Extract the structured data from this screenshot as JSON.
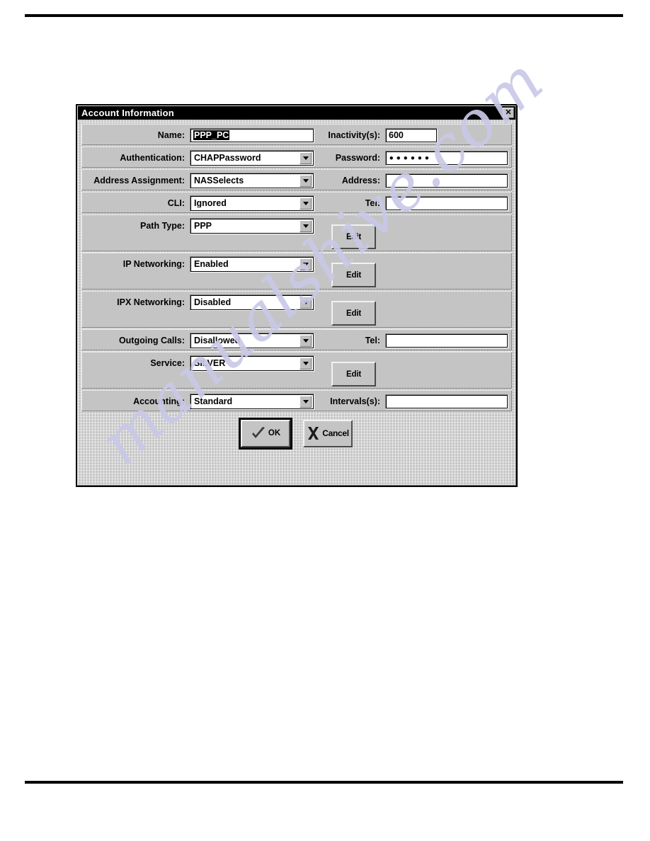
{
  "page": {
    "rule_top": "horizontal-rule",
    "rule_bottom": "horizontal-rule",
    "watermark": "manualshive.com"
  },
  "dialog": {
    "title": "Account Information",
    "close_label": "✕",
    "rows": [
      {
        "label": "Name:",
        "control": "text",
        "value": "PPP_PC",
        "selected": true,
        "right_label": "Inactivity(s):",
        "right_value": "600",
        "right_kind": "text-narrow"
      },
      {
        "label": "Authentication:",
        "control": "combo",
        "value": "CHAPPassword",
        "right_label": "Password:",
        "right_value": "••••••",
        "right_kind": "password"
      },
      {
        "label": "Address Assignment:",
        "control": "combo",
        "value": "NASSelects",
        "right_label": "Address:",
        "right_value": "",
        "right_kind": "text"
      },
      {
        "label": "CLI:",
        "control": "combo",
        "value": "Ignored",
        "right_label": "Tel:",
        "right_value": "",
        "right_kind": "text"
      },
      {
        "label": "Path Type:",
        "control": "combo",
        "value": "PPP",
        "right_kind": "edit",
        "edit_label": "Edit"
      },
      {
        "label": "IP Networking:",
        "control": "combo",
        "value": "Enabled",
        "right_kind": "edit",
        "edit_label": "Edit"
      },
      {
        "label": "IPX Networking:",
        "control": "combo",
        "value": "Disabled",
        "right_kind": "edit",
        "edit_label": "Edit"
      },
      {
        "label": "Outgoing Calls:",
        "control": "combo",
        "value": "Disallowed",
        "right_label": "Tel:",
        "right_value": "",
        "right_kind": "text"
      },
      {
        "label": "Service:",
        "control": "combo",
        "value": "SILVER",
        "right_kind": "edit",
        "edit_label": "Edit"
      },
      {
        "label": "Accounting:",
        "control": "combo",
        "value": "Standard",
        "right_label": "Intervals(s):",
        "right_value": "",
        "right_kind": "text"
      }
    ],
    "buttons": {
      "ok_label": "OK",
      "ok_icon": "checkmark-icon",
      "cancel_label": "Cancel",
      "cancel_icon": "cross-icon"
    }
  },
  "colors": {
    "dialog_face": "#c0c0c0",
    "titlebar": "#000000",
    "field_bg": "#ffffff",
    "watermark": "#c9c9e8"
  }
}
